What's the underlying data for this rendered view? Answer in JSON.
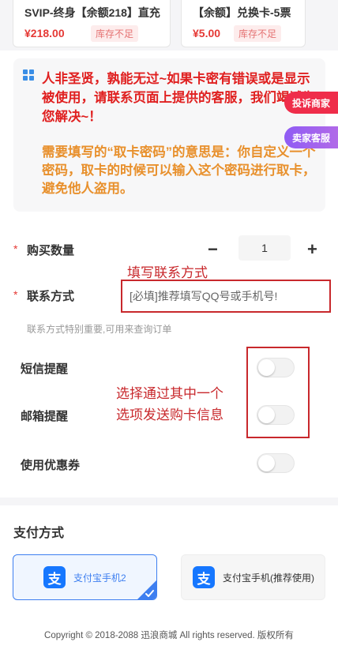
{
  "products": [
    {
      "name": "SVIP-终身【余额218】直充",
      "price": "¥218.00",
      "stock": "库存不足"
    },
    {
      "name": "【余额】兑换卡-5票",
      "price": "¥5.00",
      "stock": "库存不足"
    }
  ],
  "notice": {
    "line1": "人非圣贤，孰能无过~如果卡密有错误或是显示被使用，请联系页面上提供的客服，我们竭诚为您解决~！",
    "line2": "需要填写的“取卡密码”的意思是：你自定义一个密码，取卡的时候可以输入这个密码进行取卡，避免他人盗用。"
  },
  "float_buttons": {
    "complain": "投诉商家",
    "service": "卖家客服"
  },
  "form": {
    "required_mark": "*",
    "quantity_label": "购买数量",
    "quantity_minus": "−",
    "quantity_value": "1",
    "quantity_plus": "+",
    "contact_label": "联系方式",
    "contact_placeholder": "[必填]推荐填写QQ号或手机号!",
    "contact_hint": "联系方式特别重要,可用来查询订单"
  },
  "annotations": {
    "contact": "填写联系方式",
    "choose_1": "选择通过其中一个",
    "choose_2": "选项发送购卡信息"
  },
  "options": [
    {
      "label": "短信提醒",
      "on": false
    },
    {
      "label": "邮箱提醒",
      "on": false
    },
    {
      "label": "使用优惠券",
      "on": false
    }
  ],
  "payment": {
    "title": "支付方式",
    "methods": [
      {
        "icon": "支",
        "name": "支付宝手机2",
        "selected": true
      },
      {
        "icon": "支",
        "name": "支付宝手机(推荐使用)",
        "selected": false
      }
    ]
  },
  "footer": "Copyright © 2018-2088 迅浪商城 All rights reserved. 版权所有",
  "colors": {
    "accent": "#3e7ff0",
    "danger": "#e02020",
    "warning": "#e8902c",
    "annotation": "#c8282c"
  }
}
